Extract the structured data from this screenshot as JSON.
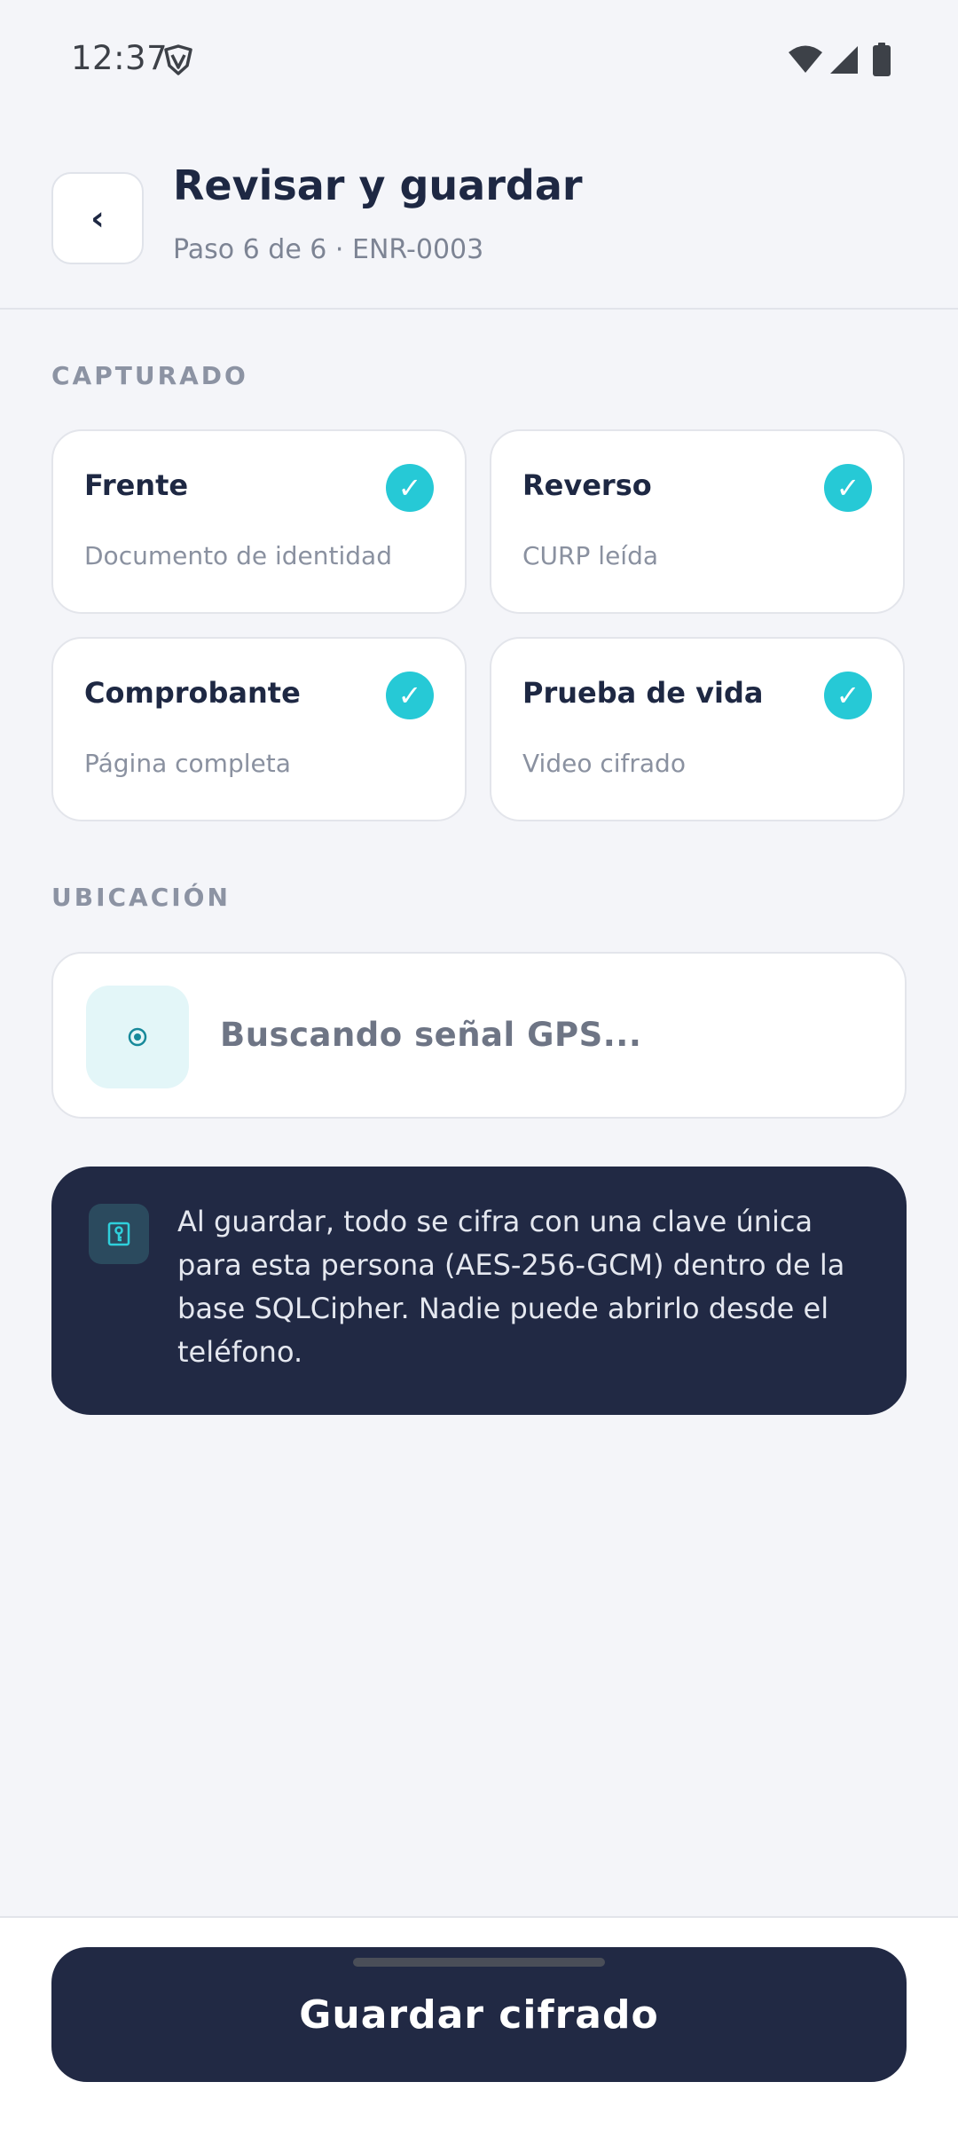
{
  "status_bar": {
    "time": "12:37",
    "icons": [
      "shield-icon",
      "wifi-icon",
      "signal-icon",
      "battery-icon"
    ]
  },
  "header": {
    "back_label": "‹",
    "title": "Revisar y guardar",
    "subtitle": "Paso 6 de 6 · ENR-0003"
  },
  "captured": {
    "section_label": "CAPTURADO",
    "items": [
      {
        "title": "Frente",
        "subtitle": "Documento de identidad",
        "status": "✓"
      },
      {
        "title": "Reverso",
        "subtitle": "CURP leída",
        "status": "✓"
      },
      {
        "title": "Comprobante",
        "subtitle": "Página completa",
        "status": "✓"
      },
      {
        "title": "Prueba de vida",
        "subtitle": "Video cifrado",
        "status": "✓"
      }
    ]
  },
  "location": {
    "section_label": "UBICACIÓN",
    "status_text": "Buscando señal GPS..."
  },
  "info": {
    "text": "Al guardar, todo se cifra con una clave única para esta persona (AES-256-GCM) dentro de la base SQLCipher. Nadie puede abrirlo desde el teléfono."
  },
  "footer": {
    "save_label": "Guardar cifrado"
  },
  "colors": {
    "accent": "#26c9d6",
    "dark": "#212944",
    "background": "#f4f5f9"
  }
}
